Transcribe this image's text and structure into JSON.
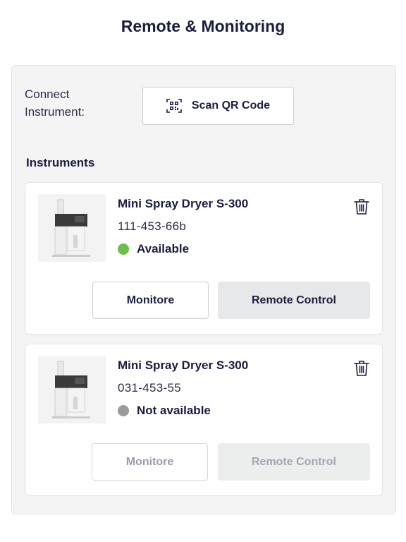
{
  "page": {
    "title": "Remote & Monitoring"
  },
  "connect": {
    "label": "Connect Instrument:",
    "scan_button_label": "Scan QR Code",
    "scan_icon": "qr-scan-icon"
  },
  "instruments": {
    "section_title": "Instruments",
    "items": [
      {
        "name": "Mini Spray Dryer S-300",
        "id": "111-453-66b",
        "status": "Available",
        "status_color": "#6cc04a",
        "monitor_label": "Monitore",
        "remote_label": "Remote Control",
        "enabled": true,
        "delete_icon": "trash-icon"
      },
      {
        "name": "Mini Spray Dryer S-300",
        "id": "031-453-55",
        "status": "Not available",
        "status_color": "#9b9b9b",
        "monitor_label": "Monitore",
        "remote_label": "Remote Control",
        "enabled": false,
        "delete_icon": "trash-icon"
      }
    ]
  },
  "colors": {
    "text_primary": "#1b1d3f",
    "panel_background": "#f4f4f4",
    "filled_button_background": "#e6e8e9",
    "available": "#6cc04a",
    "not_available": "#9b9b9b"
  }
}
